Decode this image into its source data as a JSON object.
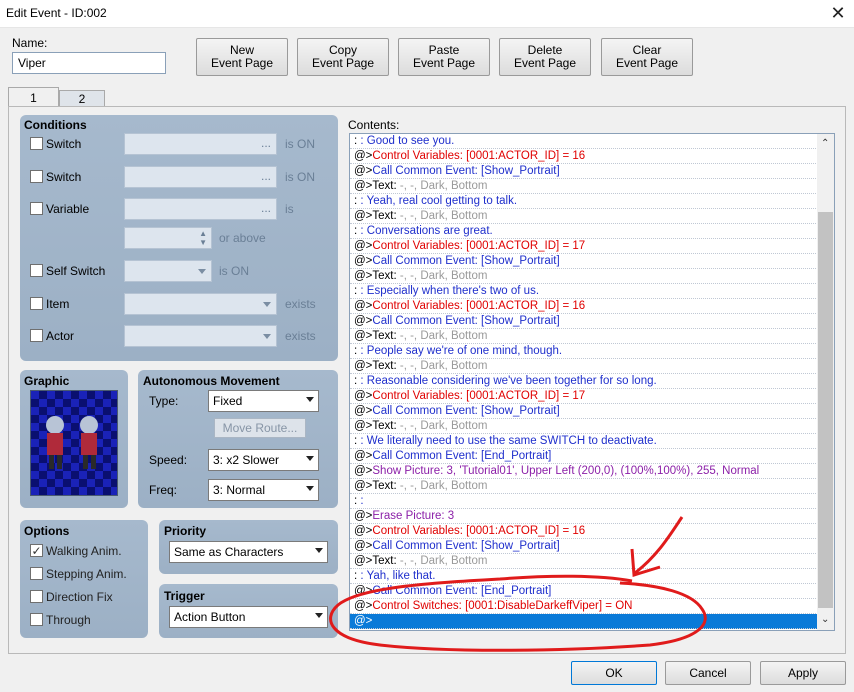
{
  "window": {
    "title": "Edit Event - ID:002",
    "close": "✕"
  },
  "name": {
    "label": "Name:",
    "value": "Viper"
  },
  "toolbar": [
    {
      "line1": "New",
      "line2": "Event Page"
    },
    {
      "line1": "Copy",
      "line2": "Event Page"
    },
    {
      "line1": "Paste",
      "line2": "Event Page"
    },
    {
      "line1": "Delete",
      "line2": "Event Page"
    },
    {
      "line1": "Clear",
      "line2": "Event Page"
    }
  ],
  "tabs": [
    "1",
    "2"
  ],
  "conditions": {
    "title": "Conditions",
    "switch1": {
      "label": "Switch",
      "suffix": "is ON",
      "dots": "..."
    },
    "switch2": {
      "label": "Switch",
      "suffix": "is ON",
      "dots": "..."
    },
    "variable": {
      "label": "Variable",
      "suffix": "is",
      "dots": "...",
      "above": "or above"
    },
    "self_switch": {
      "label": "Self Switch",
      "suffix": "is ON"
    },
    "item": {
      "label": "Item",
      "suffix": "exists"
    },
    "actor": {
      "label": "Actor",
      "suffix": "exists"
    }
  },
  "graphic": {
    "title": "Graphic"
  },
  "movement": {
    "title": "Autonomous Movement",
    "type_label": "Type:",
    "type_value": "Fixed",
    "move_route": "Move Route...",
    "speed_label": "Speed:",
    "speed_value": "3: x2 Slower",
    "freq_label": "Freq:",
    "freq_value": "3: Normal"
  },
  "options": {
    "title": "Options",
    "items": [
      {
        "label": "Walking Anim.",
        "checked": true
      },
      {
        "label": "Stepping Anim.",
        "checked": false
      },
      {
        "label": "Direction Fix",
        "checked": false
      },
      {
        "label": "Through",
        "checked": false
      }
    ]
  },
  "priority": {
    "title": "Priority",
    "value": "Same as Characters"
  },
  "trigger": {
    "title": "Trigger",
    "value": "Action Button"
  },
  "contents": {
    "label": "Contents:",
    "lines": [
      {
        "prefix": " :",
        "text": "        : Good to see you.",
        "color": "blue"
      },
      {
        "prefix": "@>",
        "text": "Control Variables: [0001:ACTOR_ID] = 16",
        "color": "red"
      },
      {
        "prefix": "@>",
        "text": "Call Common Event: [Show_Portrait]",
        "color": "blue"
      },
      {
        "prefix": "@>Text:",
        "text": " -, -, Dark, Bottom",
        "color": "gray"
      },
      {
        "prefix": " :",
        "text": "        : Yeah, real cool getting to talk.",
        "color": "blue"
      },
      {
        "prefix": "@>Text:",
        "text": " -, -, Dark, Bottom",
        "color": "gray"
      },
      {
        "prefix": " :",
        "text": "        : Conversations are great.",
        "color": "blue"
      },
      {
        "prefix": "@>",
        "text": "Control Variables: [0001:ACTOR_ID] = 17",
        "color": "red"
      },
      {
        "prefix": "@>",
        "text": "Call Common Event: [Show_Portrait]",
        "color": "blue"
      },
      {
        "prefix": "@>Text:",
        "text": " -, -, Dark, Bottom",
        "color": "gray"
      },
      {
        "prefix": " :",
        "text": "        : Especially when there's two of us.",
        "color": "blue"
      },
      {
        "prefix": "@>",
        "text": "Control Variables: [0001:ACTOR_ID] = 16",
        "color": "red"
      },
      {
        "prefix": "@>",
        "text": "Call Common Event: [Show_Portrait]",
        "color": "blue"
      },
      {
        "prefix": "@>Text:",
        "text": " -, -, Dark, Bottom",
        "color": "gray"
      },
      {
        "prefix": " :",
        "text": "        : People say we're of one mind, though.",
        "color": "blue"
      },
      {
        "prefix": "@>Text:",
        "text": " -, -, Dark, Bottom",
        "color": "gray"
      },
      {
        "prefix": " :",
        "text": "        : Reasonable considering we've been together for so long.",
        "color": "blue"
      },
      {
        "prefix": "@>",
        "text": "Control Variables: [0001:ACTOR_ID] = 17",
        "color": "red"
      },
      {
        "prefix": "@>",
        "text": "Call Common Event: [Show_Portrait]",
        "color": "blue"
      },
      {
        "prefix": "@>Text:",
        "text": " -, -, Dark, Bottom",
        "color": "gray"
      },
      {
        "prefix": " :",
        "text": "        : We literally need to use the same SWITCH to deactivate.",
        "color": "blue"
      },
      {
        "prefix": "@>",
        "text": "Call Common Event: [End_Portrait]",
        "color": "blue"
      },
      {
        "prefix": "@>",
        "text": "Show Picture: 3, 'Tutorial01', Upper Left (200,0), (100%,100%), 255, Normal",
        "color": "purple"
      },
      {
        "prefix": "@>Text:",
        "text": " -, -, Dark, Bottom",
        "color": "gray"
      },
      {
        "prefix": " :",
        "text": "        :",
        "color": "blue"
      },
      {
        "prefix": "@>",
        "text": "Erase Picture: 3",
        "color": "purple"
      },
      {
        "prefix": "@>",
        "text": "Control Variables: [0001:ACTOR_ID] = 16",
        "color": "red"
      },
      {
        "prefix": "@>",
        "text": "Call Common Event: [Show_Portrait]",
        "color": "blue"
      },
      {
        "prefix": "@>Text:",
        "text": " -, -, Dark, Bottom",
        "color": "gray"
      },
      {
        "prefix": " :",
        "text": "        : Yah, like that.",
        "color": "blue"
      },
      {
        "prefix": "@>",
        "text": "Call Common Event: [End_Portrait]",
        "color": "blue"
      },
      {
        "prefix": "@>",
        "text": "Control Switches: [0001:DisableDarkeffViper] = ON",
        "color": "red"
      },
      {
        "prefix": "@>",
        "text": "",
        "color": "black",
        "selected": true
      }
    ]
  },
  "footer": {
    "ok": "OK",
    "cancel": "Cancel",
    "apply": "Apply"
  },
  "annotation": {
    "color": "#e01b1b"
  }
}
